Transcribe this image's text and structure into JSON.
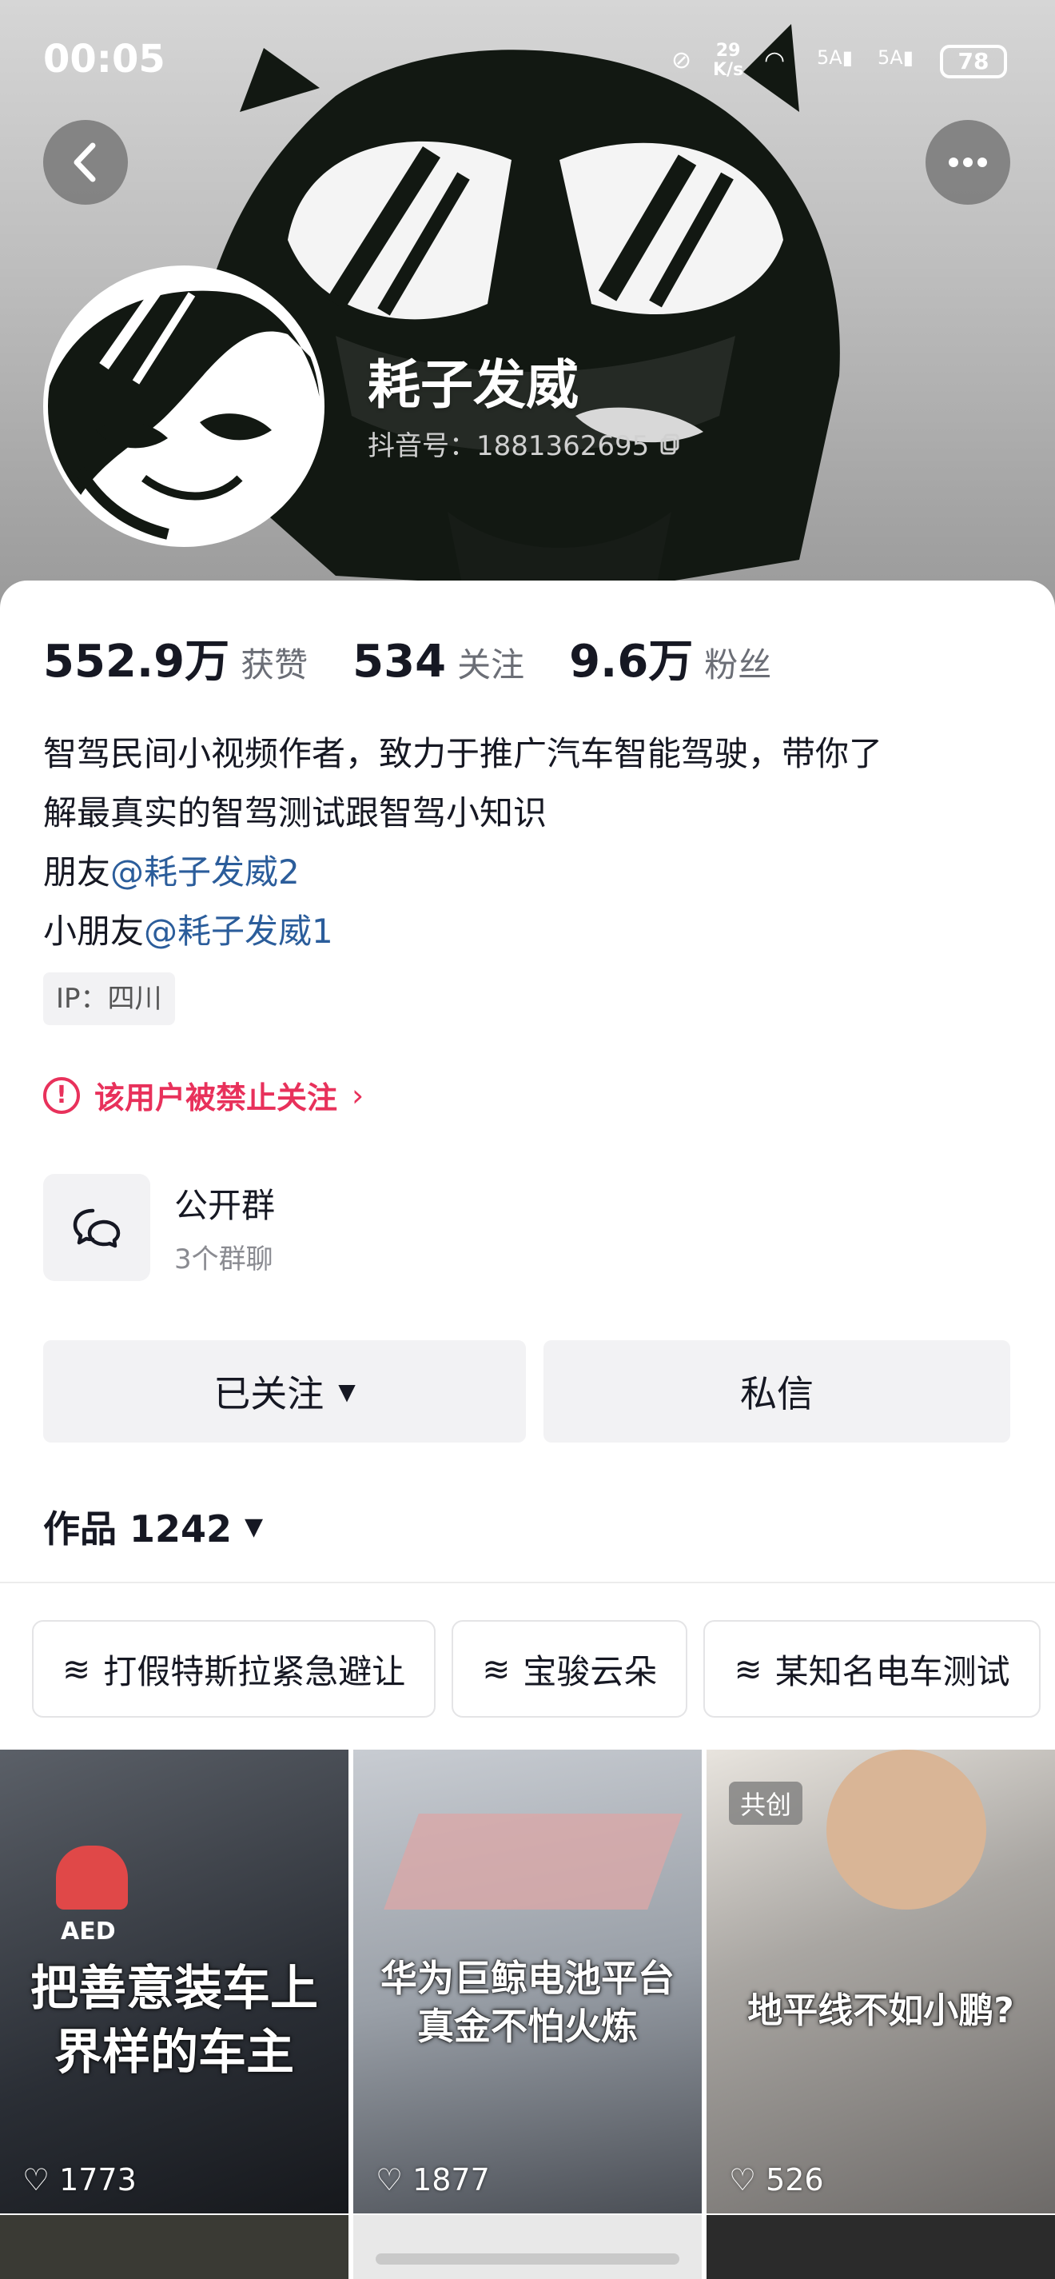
{
  "status_bar": {
    "time": "00:05",
    "net_speed_top": "29",
    "net_speed_bottom": "K/s",
    "battery": "78",
    "sig1": "5A",
    "sig2": "5A"
  },
  "profile": {
    "name": "耗子发威",
    "douyin_id": "抖音号：1881362695"
  },
  "stats": [
    {
      "value": "552.9万",
      "label": "获赞"
    },
    {
      "value": "534",
      "label": "关注"
    },
    {
      "value": "9.6万",
      "label": "粉丝"
    }
  ],
  "bio": {
    "line1": "智驾民间小视频作者，致力于推广汽车智能驾驶，带你了",
    "line2": "解最真实的智驾测试跟智驾小知识",
    "friend_prefix": "朋友",
    "friend_mention": "@耗子发威2",
    "kid_prefix": "小朋友",
    "kid_mention": "@耗子发威1"
  },
  "ip": "IP：四川",
  "banned_notice": "该用户被禁止关注",
  "group": {
    "title": "公开群",
    "subtitle": "3个群聊"
  },
  "buttons": {
    "follow": "已关注",
    "message": "私信"
  },
  "works": {
    "label": "作品 1242"
  },
  "collections": [
    "打假特斯拉紧急避让",
    "宝骏云朵",
    "某知名电车测试"
  ],
  "videos": [
    {
      "title_l1": "把善意装车上",
      "title_l2": "界样的车主",
      "likes": "1773",
      "badge": "AED"
    },
    {
      "title_l1": "华为巨鲸电池平台",
      "title_l2": "真金不怕火炼",
      "likes": "1877"
    },
    {
      "title_l1": "地平线不如小鹏?",
      "title_l2": "",
      "likes": "526",
      "tag": "共创"
    }
  ],
  "colors": {
    "accent_red": "#e8315b",
    "mention_blue": "#2b5d9b"
  }
}
